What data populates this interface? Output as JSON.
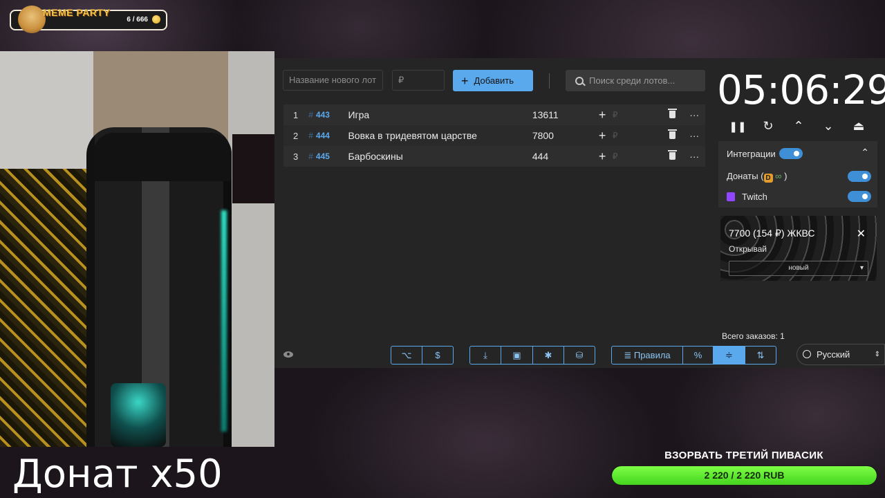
{
  "widget": {
    "title": "MEME PARTY",
    "count": "6 / 666"
  },
  "overlay": {
    "donat": "Донат x50"
  },
  "form": {
    "name_placeholder": "Название нового лот",
    "price_placeholder": "₽",
    "add_label": "Добавить",
    "search_placeholder": "Поиск среди лотов..."
  },
  "lots": [
    {
      "num": "1",
      "hash": "#",
      "id": "443",
      "name": "Игра",
      "amount": "13611",
      "plus": "+",
      "rub": "₽",
      "dots": "···"
    },
    {
      "num": "2",
      "hash": "#",
      "id": "444",
      "name": "Вовка в тридевятом царстве",
      "amount": "7800",
      "plus": "+",
      "rub": "₽",
      "dots": "···"
    },
    {
      "num": "3",
      "hash": "#",
      "id": "445",
      "name": "Барбоскины",
      "amount": "444",
      "plus": "+",
      "rub": "₽",
      "dots": "···"
    }
  ],
  "timer": {
    "value": "05:06:29",
    "controls": [
      "❚❚",
      "↻",
      "⌃",
      "⌄",
      "⏏"
    ]
  },
  "integrations": {
    "title": "Интеграции",
    "collapse": "⌃",
    "donations_prefix": "Донаты (",
    "donations_logo": "D",
    "donations_link": "∞",
    "donations_suffix": ")",
    "twitch": "Twitch",
    "accent": "#3f8fd6"
  },
  "notification": {
    "title": "7700 (154 ₽) ЖКВС",
    "subtitle": "Открывай",
    "select_value": "новый",
    "select_arrow": "▾",
    "close": "✕"
  },
  "orders": {
    "label": "Всего заказов: 1"
  },
  "toolbar": {
    "group1": [
      "⌥",
      "$"
    ],
    "group2": [
      "⤓",
      "▣",
      "✱",
      "⛁"
    ],
    "rules_label": "Правила",
    "rules_icon": "≣",
    "percent": "%",
    "center": "≑",
    "sort": "⇅"
  },
  "language": {
    "value": "Русский",
    "arrow": "⇕"
  },
  "goal": {
    "title": "ВЗОРВАТЬ ТРЕТИЙ ПИВАСИК",
    "progress_text": "2 220 / 2 220 RUB",
    "progress": 1.0,
    "fill_color": "#5be62c"
  }
}
